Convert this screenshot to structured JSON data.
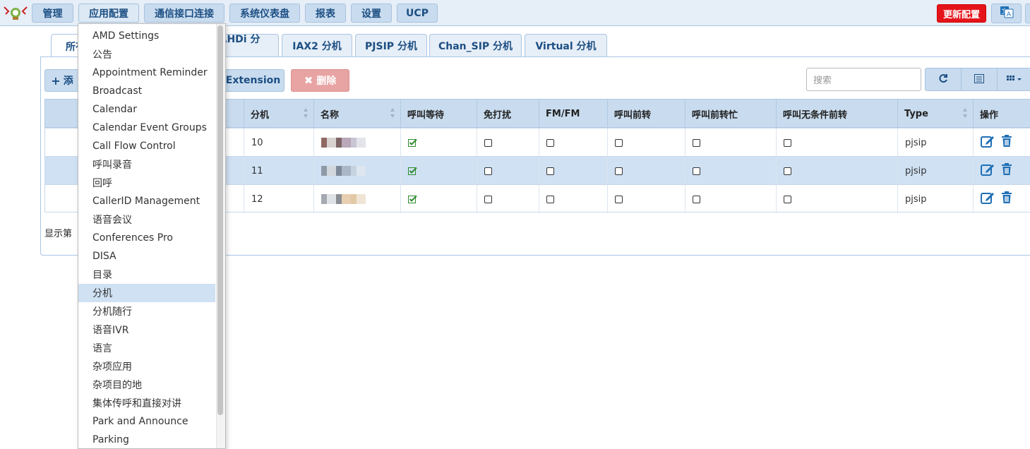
{
  "nav": {
    "items": [
      {
        "label": "管理"
      },
      {
        "label": "应用配置"
      },
      {
        "label": "通信接口连接"
      },
      {
        "label": "系统仪表盘"
      },
      {
        "label": "报表"
      },
      {
        "label": "设置"
      },
      {
        "label": "UCP"
      }
    ],
    "update_label": "更新配置",
    "language_icon": "translate-icon"
  },
  "tabs": [
    {
      "label": "所有"
    },
    {
      "label": "DAHDi 分机"
    },
    {
      "label": "IAX2 分机"
    },
    {
      "label": "PJSIP 分机"
    },
    {
      "label": "Chan_SIP 分机"
    },
    {
      "label": "Virtual 分机"
    }
  ],
  "toolbar": {
    "add_label": "添",
    "extension_label": "Extension",
    "delete_label": "删除",
    "search_placeholder": "搜索"
  },
  "table": {
    "columns": [
      "分机",
      "名称",
      "呼叫等待",
      "免打扰",
      "FM/FM",
      "呼叫前转",
      "呼叫前转忙",
      "呼叫无条件前转",
      "Type",
      "操作"
    ],
    "rows": [
      {
        "ext": "10",
        "call_waiting": true,
        "dnd": false,
        "fmfm": false,
        "cf": false,
        "cfb": false,
        "cfu": false,
        "type": "pjsip"
      },
      {
        "ext": "11",
        "call_waiting": true,
        "dnd": false,
        "fmfm": false,
        "cf": false,
        "cfb": false,
        "cfu": false,
        "type": "pjsip"
      },
      {
        "ext": "12",
        "call_waiting": true,
        "dnd": false,
        "fmfm": false,
        "cf": false,
        "cfb": false,
        "cfu": false,
        "type": "pjsip"
      }
    ]
  },
  "footer": {
    "showing": "显示第"
  },
  "menu": {
    "items": [
      "AMD Settings",
      "公告",
      "Appointment Reminder",
      "Broadcast",
      "Calendar",
      "Calendar Event Groups",
      "Call Flow Control",
      "呼叫录音",
      "回呼",
      "CallerID Management",
      "语音会议",
      "Conferences Pro",
      "DISA",
      "目录",
      "分机",
      "分机随行",
      "语音IVR",
      "语言",
      "杂项应用",
      "杂项目的地",
      "集体传呼和直接对讲",
      "Park and Announce",
      "Parking"
    ],
    "active_index": 14
  },
  "colors": {
    "nav_bg": "#c9dcef",
    "accent_text": "#1d4f83",
    "update_red": "#e5141b",
    "check_green": "#2e8b2e",
    "action_blue": "#1f6fb5"
  }
}
